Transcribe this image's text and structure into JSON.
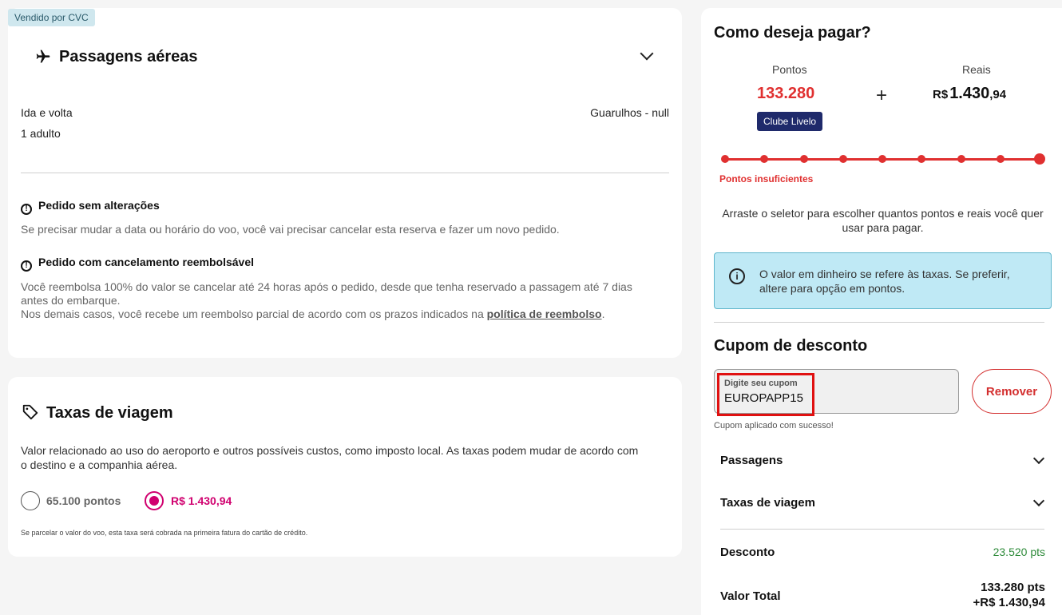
{
  "badge": "Vendido por CVC",
  "flight": {
    "title": "Passagens aéreas",
    "trip_type": "Ida e volta",
    "passengers": "1 adulto",
    "route": "Guarulhos - null",
    "notice1_title": "Pedido sem alterações",
    "notice1_text": "Se precisar mudar a data ou horário do voo, você vai precisar cancelar esta reserva e fazer um novo pedido.",
    "notice2_title": "Pedido com cancelamento reembolsável",
    "notice2_line1": "Você reembolsa 100% do valor se cancelar até 24 horas após o pedido, desde que tenha reservado a passagem até 7 dias",
    "notice2_line2": "antes do embarque.",
    "notice2_line3": "Nos demais casos, você recebe um reembolso parcial de acordo com os prazos indicados na ",
    "refund_link": "política de reembolso",
    "period": "."
  },
  "taxes": {
    "title": "Taxas de viagem",
    "desc_line1": "Valor relacionado ao uso do aeroporto e outros possíveis custos, como imposto local. As taxas podem mudar de acordo com",
    "desc_line2": "o destino e a companhia aérea.",
    "option_points": "65.100 pontos",
    "option_reais": "R$ 1.430,94",
    "footnote": "Se parcelar o valor do voo, esta taxa será cobrada na primeira fatura do cartão de crédito."
  },
  "payment": {
    "title": "Como deseja pagar?",
    "points_label": "Pontos",
    "points_value": "133.280",
    "club_badge": "Clube Livelo",
    "plus": "+",
    "reais_label": "Reais",
    "reais_currency": "R$",
    "reais_int": "1.430",
    "reais_dec": ",94",
    "slider_steps": 9,
    "slider_position": 1.0,
    "insufficient": "Pontos insuficientes",
    "hint_line1": "Arraste o seletor para escolher quantos pontos e reais você quer",
    "hint_line2": "usar para pagar.",
    "info_line1": "O valor em dinheiro se refere às taxas. Se preferir,",
    "info_line2": "altere para opção em pontos.",
    "info_icon": "i"
  },
  "coupon": {
    "title": "Cupom de desconto",
    "field_label": "Digite seu cupom",
    "value": "EUROPAPP15",
    "remove_label": "Remover",
    "success": "Cupom aplicado com sucesso!"
  },
  "summary": {
    "passagens": "Passagens",
    "taxas": "Taxas de viagem",
    "desconto_label": "Desconto",
    "desconto_value": "23.520 pts",
    "total_label": "Valor Total",
    "total_points": "133.280 pts",
    "total_reais": "+R$ 1.430,94"
  },
  "colors": {
    "accent_red": "#e03030",
    "pink": "#d0006f",
    "navy": "#1f2a6b",
    "green": "#2e8b3a"
  }
}
